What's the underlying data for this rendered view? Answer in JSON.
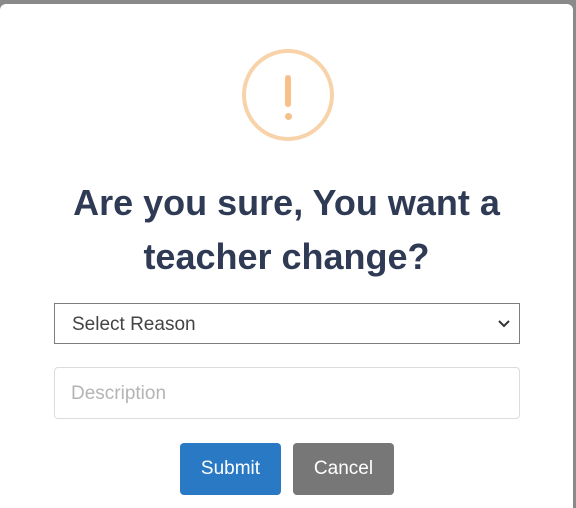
{
  "dialog": {
    "icon": "warning-exclamation-icon",
    "title": "Are you sure, You want a teacher change?",
    "reason_select": {
      "selected": "Select Reason"
    },
    "description": {
      "placeholder": "Description"
    },
    "buttons": {
      "submit": "Submit",
      "cancel": "Cancel"
    }
  },
  "colors": {
    "title": "#2f3a55",
    "submit": "#2a79c5",
    "cancel": "#777777",
    "warning": "#f8d2a8"
  }
}
